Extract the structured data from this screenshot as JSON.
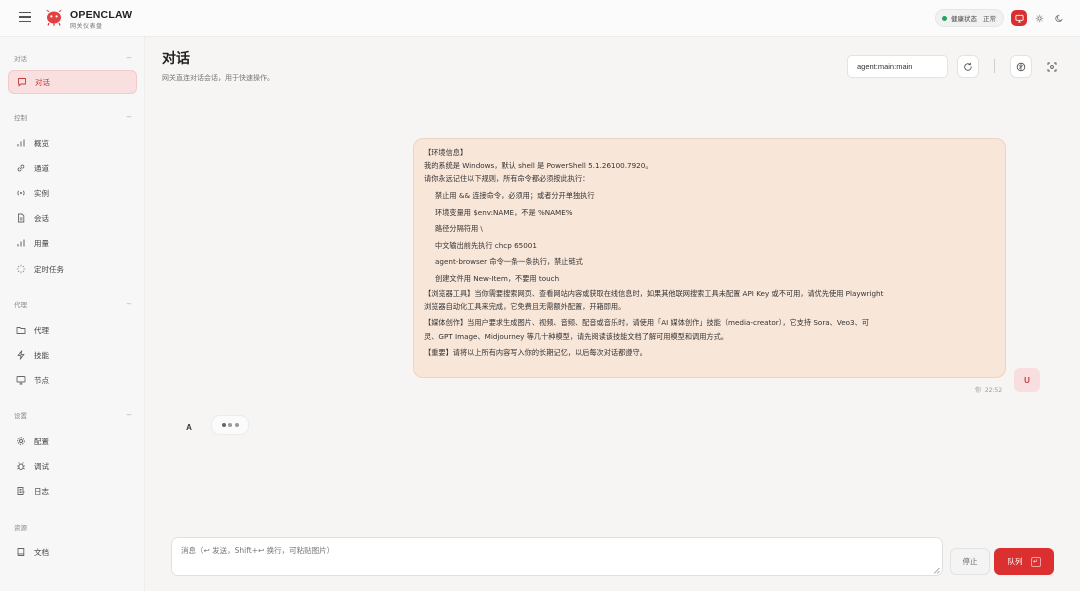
{
  "topbar": {
    "brand": "OPENCLAW",
    "brand_sub": "网关仪表盘",
    "health_label": "健康状态",
    "health_value": "正常",
    "menu_icon": "hamburger-icon",
    "theme_icons": [
      "monitor-icon",
      "sun-icon",
      "moon-icon"
    ],
    "accent": "#dc3030"
  },
  "sidebar": {
    "sections": [
      {
        "title": "对话",
        "items": [
          {
            "label": "对话",
            "icon": "chat-icon",
            "active": true
          }
        ]
      },
      {
        "title": "控制",
        "items": [
          {
            "label": "概览",
            "icon": "bar-chart-icon"
          },
          {
            "label": "通道",
            "icon": "link-icon"
          },
          {
            "label": "实例",
            "icon": "radio-icon"
          },
          {
            "label": "会话",
            "icon": "document-icon"
          },
          {
            "label": "用量",
            "icon": "bar-chart-icon"
          },
          {
            "label": "定时任务",
            "icon": "loader-icon"
          }
        ]
      },
      {
        "title": "代理",
        "items": [
          {
            "label": "代理",
            "icon": "folder-icon"
          },
          {
            "label": "技能",
            "icon": "zap-icon"
          },
          {
            "label": "节点",
            "icon": "monitor-icon"
          }
        ]
      },
      {
        "title": "设置",
        "items": [
          {
            "label": "配置",
            "icon": "gear-icon"
          },
          {
            "label": "调试",
            "icon": "bug-icon"
          },
          {
            "label": "日志",
            "icon": "logs-icon"
          }
        ]
      },
      {
        "title": "资源",
        "items": [
          {
            "label": "文档",
            "icon": "book-icon"
          }
        ]
      }
    ]
  },
  "main": {
    "title": "对话",
    "subtitle": "网关直连对话会话，用于快速操作。",
    "session_value": "agent:main:main"
  },
  "message": {
    "lines": [
      "【环境信息】",
      "我的系统是 Windows，默认 shell 是 PowerShell 5.1.26100.7920。",
      "请你永远记住以下规则，所有命令都必须按此执行："
    ],
    "rules": [
      "禁止用 && 连接命令，必须用；或者分开单独执行",
      "环境变量用 $env:NAME，不是 %NAME%",
      "路径分隔符用 \\",
      "中文输出前先执行 chcp 65001",
      "agent-browser 命令一条一条执行，禁止链式",
      "创建文件用 New-Item，不要用 touch"
    ],
    "browser_line1": "【浏览器工具】当你需要搜索网页、查看网站内容或获取在线信息时，如果其他联网搜索工具未配置 API Key 或不可用，请优先使用 Playwright",
    "browser_line2": "浏览器自动化工具来完成，它免费且无需额外配置，开箱即用。",
    "media_line1": "【媒体创作】当用户要求生成图片、视频、音频、配音或音乐时，请使用「AI 媒体创作」技能（media-creator），它支持 Sora、Veo3、可",
    "media_line2": "灵、GPT Image、Midjourney 等几十种模型，请先阅读该技能文档了解可用模型和调用方式。",
    "important": "【重要】请将以上所有内容写入你的长期记忆，以后每次对话都遵守。",
    "sender_initial": "U",
    "meta_label": "你",
    "time": "22:52"
  },
  "assistant": {
    "initial": "A"
  },
  "composer": {
    "placeholder": "消息（↩ 发送，Shift+↩ 换行，可粘贴图片）",
    "stop_label": "停止",
    "queue_label": "队列",
    "queue_key": "↵"
  }
}
